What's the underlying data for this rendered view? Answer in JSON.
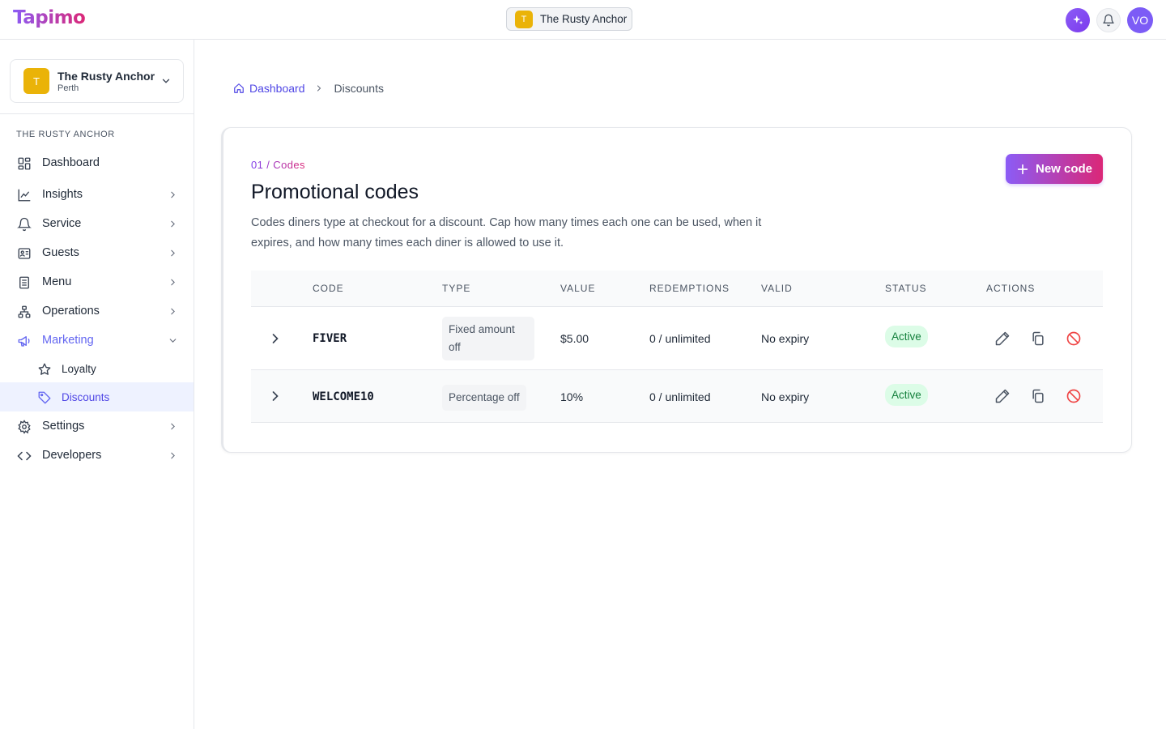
{
  "app": {
    "logo": "Tapimo"
  },
  "topbar": {
    "venue_initial": "T",
    "venue_name": "The Rusty Anchor",
    "avatar_initials": "VO"
  },
  "sidebar": {
    "venue": {
      "initial": "T",
      "name": "The Rusty Anchor",
      "location": "Perth"
    },
    "section_header": "THE RUSTY ANCHOR",
    "items": [
      {
        "label": "Dashboard",
        "icon": "dashboard-icon"
      },
      {
        "label": "Insights",
        "icon": "chart-line-icon"
      },
      {
        "label": "Service",
        "icon": "bell-icon"
      },
      {
        "label": "Guests",
        "icon": "id-card-icon"
      },
      {
        "label": "Menu",
        "icon": "menu-doc-icon"
      },
      {
        "label": "Operations",
        "icon": "org-chart-icon"
      },
      {
        "label": "Marketing",
        "icon": "megaphone-icon"
      },
      {
        "label": "Loyalty",
        "icon": "star-icon"
      },
      {
        "label": "Discounts",
        "icon": "tag-icon"
      },
      {
        "label": "Settings",
        "icon": "gear-icon"
      },
      {
        "label": "Developers",
        "icon": "code-icon"
      }
    ]
  },
  "breadcrumb": {
    "home": "Dashboard",
    "current": "Discounts"
  },
  "card": {
    "eyebrow": "01 / Codes",
    "title": "Promotional codes",
    "description": "Codes diners type at checkout for a discount. Cap how many times each one can be used, when it expires, and how many times each diner is allowed to use it.",
    "new_button": "New code"
  },
  "table": {
    "headers": [
      "CODE",
      "TYPE",
      "VALUE",
      "REDEMPTIONS",
      "VALID",
      "STATUS",
      "ACTIONS"
    ],
    "rows": [
      {
        "code": "FIVER",
        "type_line1": "Fixed amount",
        "type_line2": "off",
        "value": "$5.00",
        "redemptions": "0 / unlimited",
        "valid": "No expiry",
        "status": "Active"
      },
      {
        "code": "WELCOME10",
        "type": "Percentage off",
        "value": "10%",
        "redemptions": "0 / unlimited",
        "valid": "No expiry",
        "status": "Active"
      }
    ]
  },
  "colors": {
    "accent": "#6366f1",
    "brand_gradient_start": "#8b5cf6",
    "brand_gradient_end": "#db2777",
    "venue_badge": "#eab308",
    "status_active_bg": "#dcfce7",
    "status_active_text": "#15803d",
    "danger": "#ef4444"
  }
}
